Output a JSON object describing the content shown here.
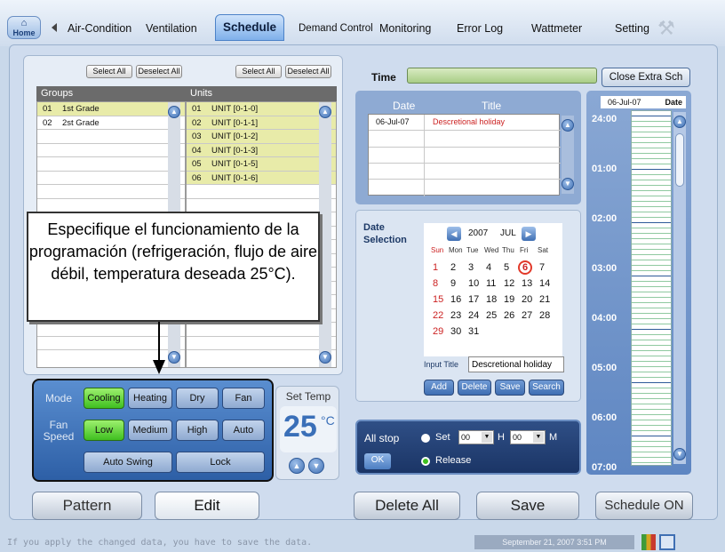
{
  "nav": {
    "home_label": "Home",
    "tabs": [
      "Air-Condition",
      "Ventilation",
      "Schedule",
      "Demand Control",
      "Monitoring",
      "Error Log",
      "Wattmeter",
      "Setting"
    ],
    "active_tab": "Schedule"
  },
  "groups": {
    "select_all": "Select All",
    "deselect_all": "Deselect All",
    "header": "Groups",
    "rows": [
      {
        "num": "01",
        "name": "1st Grade"
      },
      {
        "num": "02",
        "name": "2st Grade"
      }
    ]
  },
  "units": {
    "select_all": "Select All",
    "deselect_all": "Deselect All",
    "header": "Units",
    "rows": [
      {
        "num": "01",
        "name": "UNIT [0-1-0]"
      },
      {
        "num": "02",
        "name": "UNIT [0-1-1]"
      },
      {
        "num": "03",
        "name": "UNIT [0-1-2]"
      },
      {
        "num": "04",
        "name": "UNIT [0-1-3]"
      },
      {
        "num": "05",
        "name": "UNIT [0-1-5]"
      },
      {
        "num": "06",
        "name": "UNIT [0-1-6]"
      }
    ]
  },
  "callout": {
    "text": "Especifique el funcionamiento de la programación (refrigeración, flujo de aire débil, temperatura deseada 25°C)."
  },
  "mode_panel": {
    "mode_label": "Mode",
    "modes": [
      "Cooling",
      "Heating",
      "Dry",
      "Fan"
    ],
    "active_mode": "Cooling",
    "fan_label_line1": "Fan",
    "fan_label_line2": "Speed",
    "fan_speeds": [
      "Low",
      "Medium",
      "High",
      "Auto"
    ],
    "active_fan": "Low",
    "auto_swing": "Auto Swing",
    "lock": "Lock",
    "set_temp_label": "Set Temp",
    "temp_value": "25",
    "temp_unit": "°C"
  },
  "time": {
    "label": "Time",
    "close_extra": "Close Extra Sch"
  },
  "holiday_table": {
    "col_date": "Date",
    "col_title": "Title",
    "rows": [
      {
        "date": "06-Jul-07",
        "title": "Descretional holiday"
      }
    ]
  },
  "date_selection": {
    "label_line1": "Date",
    "label_line2": "Selection",
    "year": "2007",
    "month": "JUL",
    "days": [
      "Sun",
      "Mon",
      "Tue",
      "Wed",
      "Thu",
      "Fri",
      "Sat"
    ],
    "weeks": [
      [
        "1",
        "2",
        "3",
        "4",
        "5",
        "6",
        "7"
      ],
      [
        "8",
        "9",
        "10",
        "11",
        "12",
        "13",
        "14"
      ],
      [
        "15",
        "16",
        "17",
        "18",
        "19",
        "20",
        "21"
      ],
      [
        "22",
        "23",
        "24",
        "25",
        "26",
        "27",
        "28"
      ],
      [
        "29",
        "30",
        "31",
        "",
        "",
        "",
        ""
      ]
    ],
    "highlighted_day": "6",
    "input_title_label": "Input Title",
    "input_title_value": "Descretional holiday",
    "buttons": [
      "Add",
      "Delete",
      "Save",
      "Search"
    ]
  },
  "allstop": {
    "label": "All stop",
    "ok": "OK",
    "set_label": "Set",
    "hour_value": "00",
    "hour_unit": "H",
    "min_value": "00",
    "min_unit": "M",
    "release_label": "Release"
  },
  "timeline": {
    "date": "06-Jul-07",
    "date_label": "Date",
    "hours": [
      "24:00",
      "01:00",
      "02:00",
      "03:00",
      "04:00",
      "05:00",
      "06:00",
      "07:00"
    ]
  },
  "bottom": {
    "pattern": "Pattern",
    "edit": "Edit",
    "delete_all": "Delete All",
    "save": "Save",
    "schedule_on": "Schedule ON"
  },
  "footer": {
    "message": "If you apply the changed data,  you have to save the data.",
    "datetime": "September 21, 2007 3:51 PM"
  },
  "colors": {
    "accent": "#3f6fb3",
    "active_green": "#3fbf20",
    "holiday_red": "#cc2222"
  }
}
